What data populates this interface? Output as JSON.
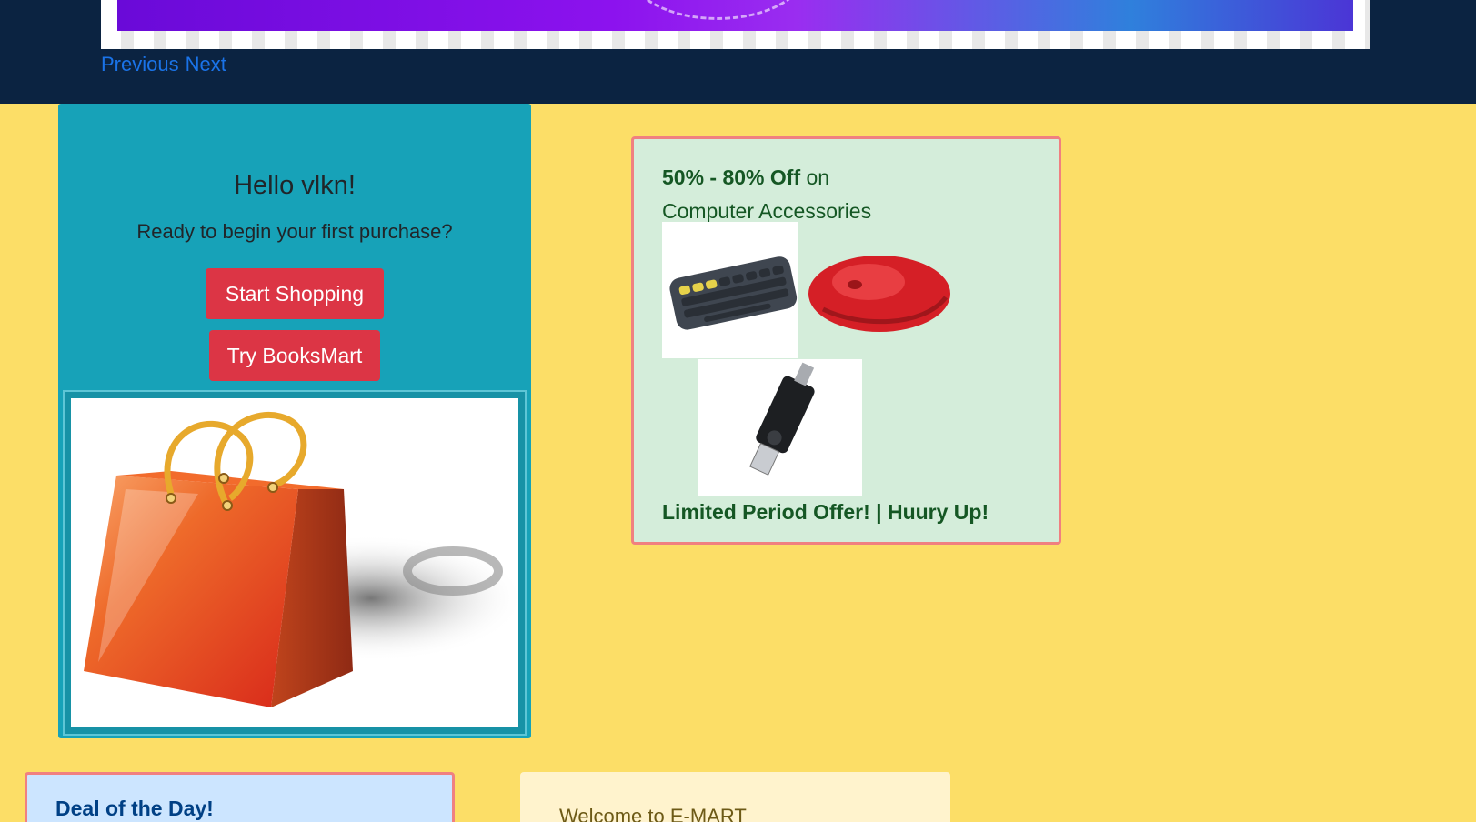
{
  "carousel": {
    "prev_label": "Previous",
    "next_label": "Next"
  },
  "welcome": {
    "greeting": "Hello vlkn!",
    "subtitle": "Ready to begin your first purchase?",
    "start_button": "Start Shopping",
    "books_button": "Try BooksMart"
  },
  "promo": {
    "discount": "50% - 80% Off",
    "on_text": " on",
    "category": "Computer Accessories",
    "footer": "Limited Period Offer! | Huury Up!",
    "products": [
      "keyboard-image",
      "mouse-image",
      "usb-drive-image"
    ]
  },
  "deal": {
    "title": "Deal of the Day!"
  },
  "emart": {
    "welcome_text": "Welcome to E-MART"
  },
  "colors": {
    "page_bg": "#fcde67",
    "nav_bg": "#0b2341",
    "welcome_card": "#17a2b8",
    "danger_button": "#dc3545",
    "promo_card": "#d4edda",
    "deal_card": "#cce5ff",
    "emart_card": "#fff3cd",
    "link": "#1a73e8"
  }
}
